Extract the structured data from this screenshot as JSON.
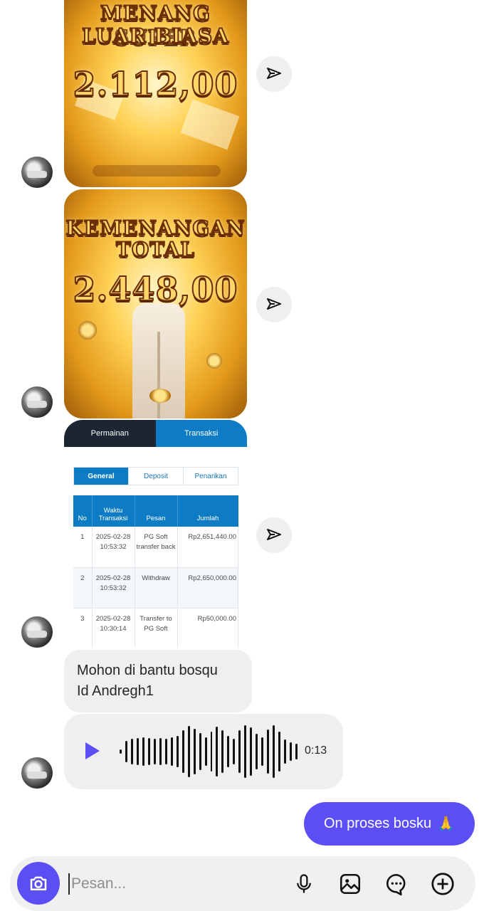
{
  "images": [
    {
      "line1": "MENANG SUPER",
      "line2": "LUAR BIASA",
      "amount": "2.112,00"
    },
    {
      "line1": "KEMENANGAN",
      "line2": "TOTAL",
      "amount": "2.448,00"
    }
  ],
  "screenshot": {
    "tabs": [
      "Permainan",
      "Transaksi"
    ],
    "subtabs": [
      "General",
      "Deposit",
      "Penarikan"
    ],
    "headers": [
      "No",
      "Waktu Transaksi",
      "Pesan",
      "Jumlah"
    ],
    "rows": [
      {
        "no": "1",
        "time": "2025-02-28 10:53:32",
        "msg": "PG Soft transfer back",
        "amount": "Rp2,651,440.00"
      },
      {
        "no": "2",
        "time": "2025-02-28 10:53:32",
        "msg": "Withdraw",
        "amount": "Rp2,650,000.00"
      },
      {
        "no": "3",
        "time": "2025-02-28 10:30:14",
        "msg": "Transfer to PG Soft",
        "amount": "Rp50,000.00"
      }
    ]
  },
  "messages": {
    "received_text": "Mohon di bantu bosqu\nId Andregh1",
    "voice_duration": "0:13",
    "sent_text": "On proses bosku",
    "sent_emoji": "🙏"
  },
  "composer": {
    "placeholder": "Pesan..."
  },
  "colors": {
    "accent": "#5b4ef5",
    "bubble_gray": "#efefef",
    "table_blue": "#0e7cc4"
  }
}
